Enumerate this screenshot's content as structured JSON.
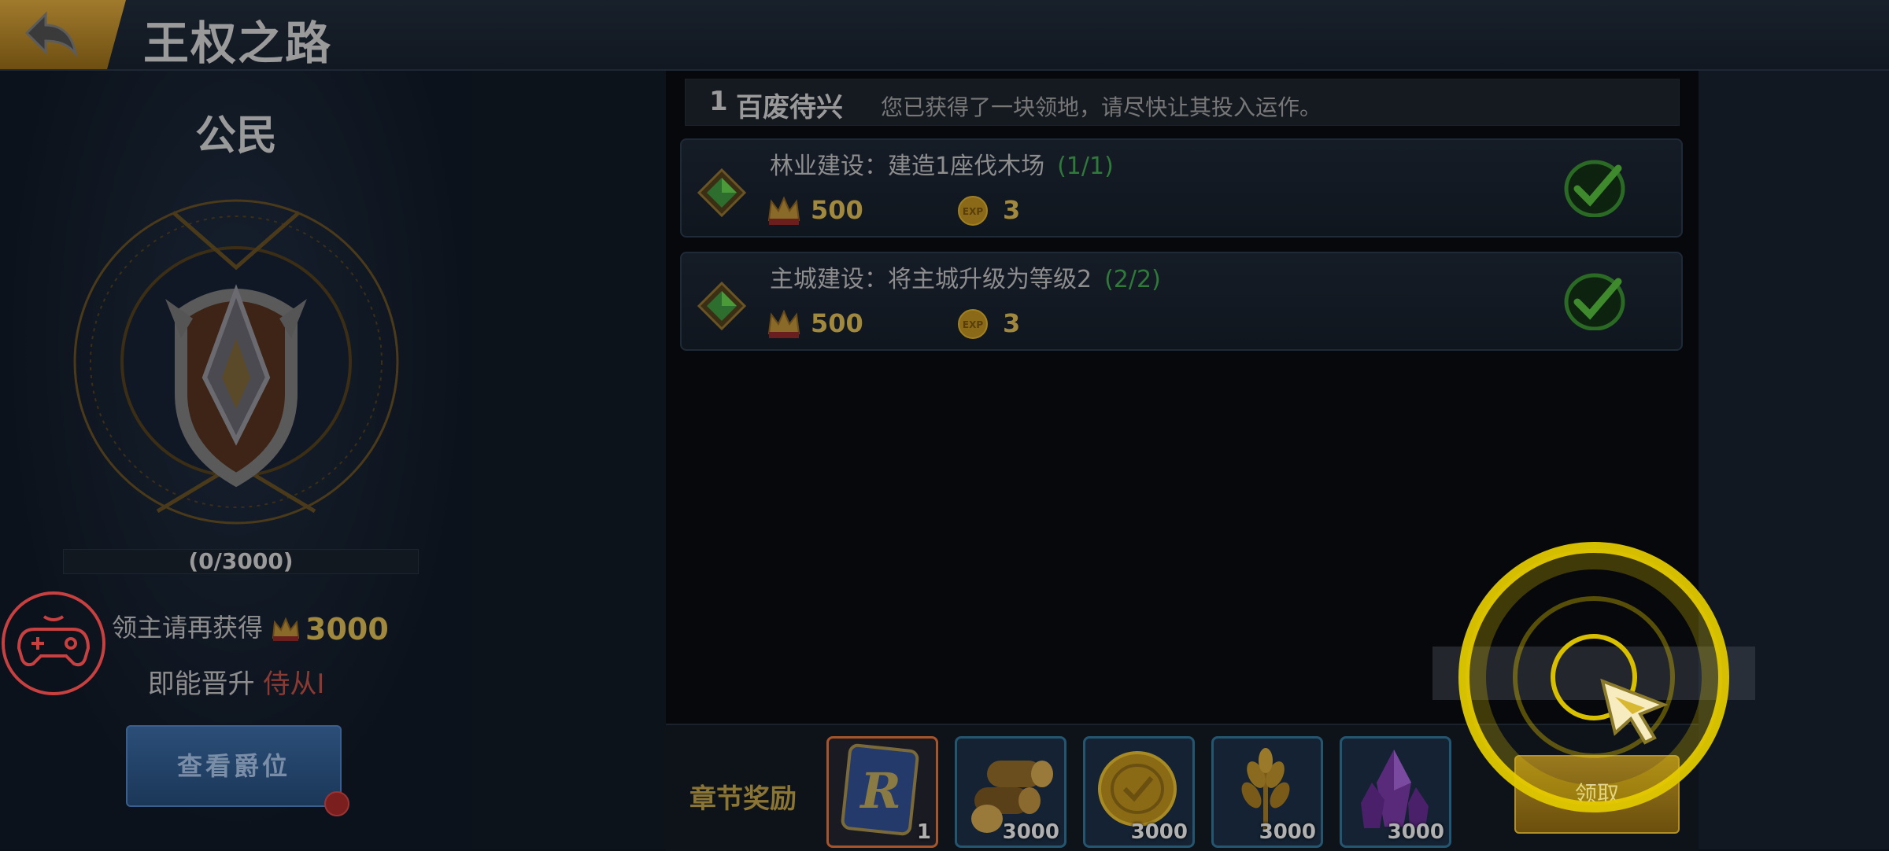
{
  "header": {
    "title": "王权之路",
    "back_icon": "back-arrow-icon"
  },
  "rank": {
    "title": "公民",
    "progress_text": "(0/3000)",
    "progress_current": 0,
    "progress_max": 3000,
    "requirement_prefix": "领主请再获得",
    "requirement_amount": "3000",
    "promote_prefix": "即能晋升",
    "next_rank": "侍从I",
    "view_button": "查看爵位"
  },
  "chapter": {
    "number": "1",
    "name": "百废待兴",
    "description": "您已获得了一块领地，请尽快让其投入运作。"
  },
  "tasks": [
    {
      "text": "林业建设：建造1座伐木场",
      "progress": "(1/1)",
      "crown_reward": "500",
      "exp_reward": "3",
      "completed": true
    },
    {
      "text": "主城建设：将主城升级为等级2",
      "progress": "(2/2)",
      "crown_reward": "500",
      "exp_reward": "3",
      "completed": true
    }
  ],
  "chapter_rewards": {
    "label": "章节奖励",
    "items": [
      {
        "icon": "r-card-icon",
        "count": "1"
      },
      {
        "icon": "wood-logs-icon",
        "count": "3000"
      },
      {
        "icon": "gold-coin-icon",
        "count": "3000"
      },
      {
        "icon": "wheat-icon",
        "count": "3000"
      },
      {
        "icon": "purple-crystal-icon",
        "count": "3000"
      }
    ],
    "claim_button": "领取"
  },
  "colors": {
    "gold_text": "#a0883e",
    "progress_green": "#2f7a3a",
    "next_rank_red": "#8a3a33",
    "highlight_yellow": "#f0d000"
  }
}
